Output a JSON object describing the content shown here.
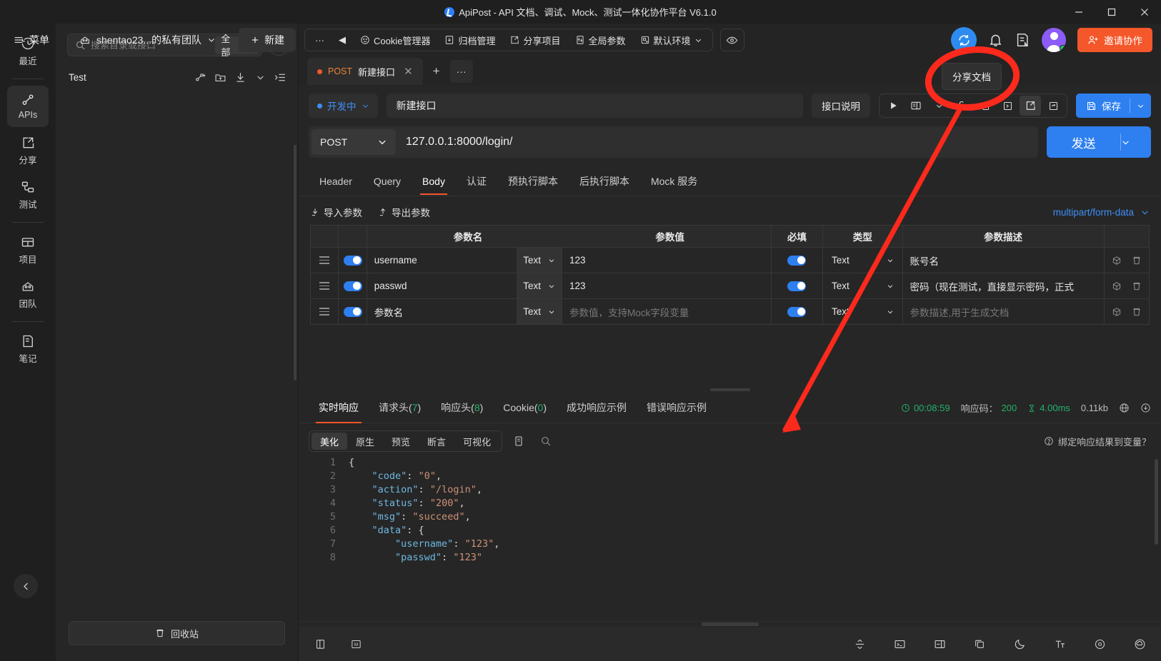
{
  "window": {
    "title": "ApiPost - API 文档、调试、Mock、测试一体化协作平台 V6.1.0",
    "minimize": "–",
    "maximize": "□",
    "close": "✕"
  },
  "header": {
    "menu_label": "菜单",
    "team_label": "shentao23...的私有团队",
    "new_label": "新建",
    "toolbar_items": [
      {
        "label": "Cookie管理器",
        "icon": "cookie-icon"
      },
      {
        "label": "归档管理",
        "icon": "archive-icon"
      },
      {
        "label": "分享项目",
        "icon": "share-icon"
      },
      {
        "label": "全局参数",
        "icon": "global-param-icon"
      },
      {
        "label": "默认环境",
        "icon": "environment-icon"
      }
    ],
    "more_label": "···",
    "back_label": "◀",
    "invite_label": "邀请协作"
  },
  "rail": {
    "items": [
      {
        "label": "最近",
        "icon": "history-icon",
        "active": false
      },
      {
        "label": "APIs",
        "icon": "api-icon",
        "active": true
      },
      {
        "label": "分享",
        "icon": "share-icon",
        "active": false
      },
      {
        "label": "测试",
        "icon": "test-icon",
        "active": false
      },
      {
        "label": "项目",
        "icon": "project-icon",
        "active": false
      },
      {
        "label": "团队",
        "icon": "team-icon",
        "active": false
      },
      {
        "label": "笔记",
        "icon": "notes-icon",
        "active": false
      }
    ]
  },
  "tree": {
    "search_placeholder": "搜索目录或接口",
    "search_value": "",
    "scope": "全部",
    "root_item": "Test",
    "trash_label": "回收站"
  },
  "tabs": {
    "items": [
      {
        "method": "POST",
        "name": "新建接口",
        "modified": true
      }
    ],
    "add_label": "+",
    "more_label": "···"
  },
  "request": {
    "status": "开发中",
    "name": "新建接口",
    "desc_button": "接口说明",
    "save_label": "保存",
    "method": "POST",
    "url": "127.0.0.1:8000/login/",
    "send_label": "发送",
    "tabs": [
      {
        "label": "Header",
        "active": false
      },
      {
        "label": "Query",
        "active": false
      },
      {
        "label": "Body",
        "active": true
      },
      {
        "label": "认证",
        "active": false
      },
      {
        "label": "预执行脚本",
        "active": false
      },
      {
        "label": "后执行脚本",
        "active": false
      },
      {
        "label": "Mock 服务",
        "active": false
      }
    ],
    "import_label": "导入参数",
    "export_label": "导出参数",
    "content_type": "multipart/form-data"
  },
  "params_table": {
    "columns": [
      "参数名",
      "参数值",
      "必填",
      "类型",
      "参数描述"
    ],
    "rows": [
      {
        "name": "username",
        "name_type": "Text",
        "value": "123",
        "required": true,
        "type": "Text",
        "desc": "账号名",
        "placeholder_name": "",
        "placeholder_value": "",
        "placeholder_desc": ""
      },
      {
        "name": "passwd",
        "name_type": "Text",
        "value": "123",
        "required": true,
        "type": "Text",
        "desc": "密码（现在测试，直接显示密码，正式",
        "placeholder_name": "",
        "placeholder_value": "",
        "placeholder_desc": ""
      },
      {
        "name": "",
        "name_type": "Text",
        "value": "",
        "required": true,
        "type": "Text",
        "desc": "",
        "placeholder_name": "参数名",
        "placeholder_value": "参数值，支持Mock字段变量",
        "placeholder_desc": "参数描述,用于生成文档"
      }
    ]
  },
  "response": {
    "tabs": [
      {
        "label": "实时响应",
        "count": null,
        "active": true
      },
      {
        "label": "请求头",
        "count": "7",
        "active": false
      },
      {
        "label": "响应头",
        "count": "8",
        "active": false
      },
      {
        "label": "Cookie",
        "count": "0",
        "active": false
      },
      {
        "label": "成功响应示例",
        "count": null,
        "active": false
      },
      {
        "label": "错误响应示例",
        "count": null,
        "active": false
      }
    ],
    "time": "00:08:59",
    "status_label": "响应码：",
    "status_code": "200",
    "duration": "4.00ms",
    "size": "0.11kb",
    "view_tabs": [
      {
        "label": "美化",
        "active": true
      },
      {
        "label": "原生",
        "active": false
      },
      {
        "label": "预览",
        "active": false
      },
      {
        "label": "断言",
        "active": false
      },
      {
        "label": "可视化",
        "active": false
      }
    ],
    "bind_hint": "绑定响应结果到变量？",
    "code_lines": [
      {
        "n": "1",
        "segs": [
          {
            "t": "{",
            "c": "p"
          }
        ]
      },
      {
        "n": "2",
        "segs": [
          {
            "t": "    ",
            "c": "p"
          },
          {
            "t": "\"code\"",
            "c": "k"
          },
          {
            "t": ": ",
            "c": "p"
          },
          {
            "t": "\"0\"",
            "c": "s"
          },
          {
            "t": ",",
            "c": "p"
          }
        ]
      },
      {
        "n": "3",
        "segs": [
          {
            "t": "    ",
            "c": "p"
          },
          {
            "t": "\"action\"",
            "c": "k"
          },
          {
            "t": ": ",
            "c": "p"
          },
          {
            "t": "\"/login\"",
            "c": "s"
          },
          {
            "t": ",",
            "c": "p"
          }
        ]
      },
      {
        "n": "4",
        "segs": [
          {
            "t": "    ",
            "c": "p"
          },
          {
            "t": "\"status\"",
            "c": "k"
          },
          {
            "t": ": ",
            "c": "p"
          },
          {
            "t": "\"200\"",
            "c": "s"
          },
          {
            "t": ",",
            "c": "p"
          }
        ]
      },
      {
        "n": "5",
        "segs": [
          {
            "t": "    ",
            "c": "p"
          },
          {
            "t": "\"msg\"",
            "c": "k"
          },
          {
            "t": ": ",
            "c": "p"
          },
          {
            "t": "\"succeed\"",
            "c": "s"
          },
          {
            "t": ",",
            "c": "p"
          }
        ]
      },
      {
        "n": "6",
        "segs": [
          {
            "t": "    ",
            "c": "p"
          },
          {
            "t": "\"data\"",
            "c": "k"
          },
          {
            "t": ": {",
            "c": "p"
          }
        ]
      },
      {
        "n": "7",
        "segs": [
          {
            "t": "        ",
            "c": "p"
          },
          {
            "t": "\"username\"",
            "c": "k"
          },
          {
            "t": ": ",
            "c": "p"
          },
          {
            "t": "\"123\"",
            "c": "s"
          },
          {
            "t": ",",
            "c": "p"
          }
        ]
      },
      {
        "n": "8",
        "segs": [
          {
            "t": "        ",
            "c": "p"
          },
          {
            "t": "\"passwd\"",
            "c": "k"
          },
          {
            "t": ": ",
            "c": "p"
          },
          {
            "t": "\"123\"",
            "c": "s"
          }
        ]
      }
    ]
  },
  "annotation": {
    "tooltip": "分享文档",
    "highlight_color": "#fc2a1c"
  },
  "colors": {
    "accent_blue": "#2e7ff0",
    "accent_orange": "#f4572a",
    "post_orange": "#f08437",
    "green": "#23b26d",
    "purple": "#8b5cf6"
  }
}
